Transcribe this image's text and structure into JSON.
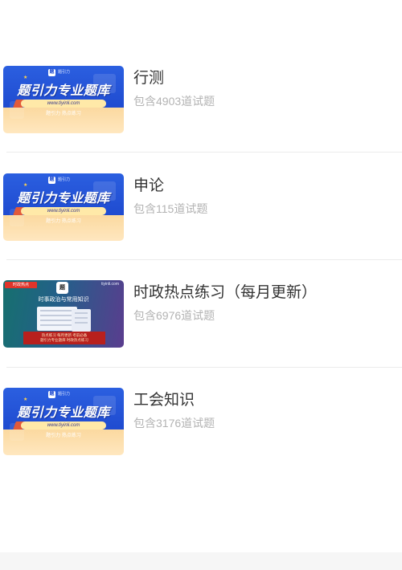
{
  "courses": [
    {
      "name": "行测",
      "count": "包含4903道试题",
      "thumb": {
        "title": "题引力专业题库",
        "url": "www.tiyinli.com",
        "tagline": "题引力 热点练习",
        "logo": "题引力"
      }
    },
    {
      "name": "申论",
      "count": "包含115道试题",
      "thumb": {
        "title": "题引力专业题库",
        "url": "www.tiyinli.com",
        "tagline": "题引力 热点练习",
        "logo": "题引力"
      }
    },
    {
      "name": "时政热点练习（每月更新）",
      "count": "包含6976道试题",
      "thumb": {
        "badge": "时政热点",
        "site": "tiyinli.com",
        "mark": "题",
        "headline": "时事政治与常用知识",
        "footer_1": "热点练习 每月更新 考前必备",
        "footer_2": "题引力专业题库 时政热点练习"
      }
    },
    {
      "name": "工会知识",
      "count": "包含3176道试题",
      "thumb": {
        "title": "题引力专业题库",
        "url": "www.tiyinli.com",
        "tagline": "题引力 热点练习",
        "logo": "题引力"
      }
    }
  ],
  "colors": {
    "title_text": "#333333",
    "count_text": "#b3b3b3",
    "banner_blue": "#2b5fe0",
    "divider": "#ececec"
  }
}
